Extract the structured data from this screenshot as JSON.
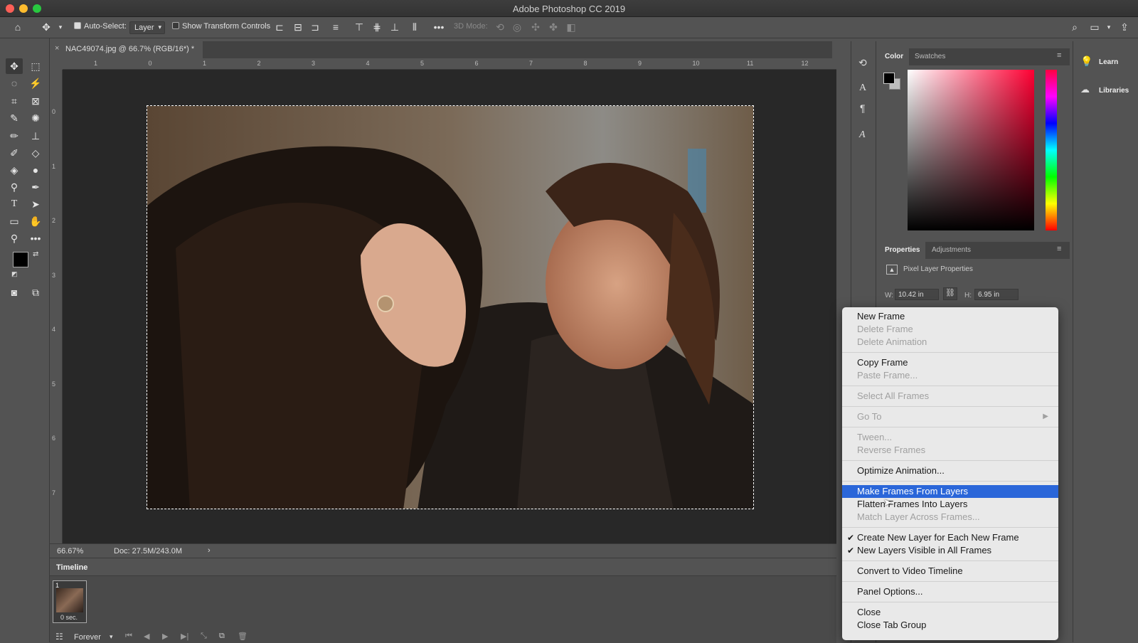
{
  "app": {
    "window_title": "Adobe Photoshop CC 2019"
  },
  "options_bar": {
    "auto_select_label": "Auto-Select:",
    "auto_select_value": "Layer",
    "show_transform_label": "Show Transform Controls",
    "mode_3d_label": "3D Mode:"
  },
  "document": {
    "tab_title": "NAC49074.jpg @ 66.7% (RGB/16*) *",
    "zoom": "66.67%",
    "doc_size": "Doc: 27.5M/243.0M",
    "ruler_h_ticks": [
      "1",
      "0",
      "1",
      "2",
      "3",
      "4",
      "5",
      "6",
      "7",
      "8",
      "9",
      "10",
      "11",
      "12"
    ],
    "ruler_v_ticks": [
      "0",
      "1",
      "2",
      "3",
      "4",
      "5",
      "6",
      "7"
    ]
  },
  "timeline": {
    "tab_label": "Timeline",
    "frame_number": "1",
    "frame_delay": "0 sec.",
    "loop_value": "Forever"
  },
  "color_panel": {
    "tabs": [
      "Color",
      "Swatches"
    ]
  },
  "properties_panel": {
    "tabs": [
      "Properties",
      "Adjustments"
    ],
    "title": "Pixel Layer Properties",
    "w_label": "W:",
    "w_value": "10.42 in",
    "h_label": "H:",
    "h_value": "6.95 in"
  },
  "right_panel": {
    "learn": "Learn",
    "libraries": "Libraries"
  },
  "context_menu": {
    "new_frame": "New Frame",
    "delete_frame": "Delete Frame",
    "delete_animation": "Delete Animation",
    "copy_frame": "Copy Frame",
    "paste_frame": "Paste Frame...",
    "select_all_frames": "Select All Frames",
    "go_to": "Go To",
    "tween": "Tween...",
    "reverse_frames": "Reverse Frames",
    "optimize_animation": "Optimize Animation...",
    "make_frames_from_layers": "Make Frames From Layers",
    "flatten_frames": "Flatten Frames Into Layers",
    "match_layer": "Match Layer Across Frames...",
    "create_new_layer": "Create New Layer for Each New Frame",
    "new_layers_visible": "New Layers Visible in All Frames",
    "convert_video": "Convert to Video Timeline",
    "panel_options": "Panel Options...",
    "close": "Close",
    "close_tab_group": "Close Tab Group"
  },
  "colors": {
    "menu_highlight": "#2a66d9",
    "canvas_bg": "#282828",
    "ui_bg": "#535353"
  }
}
